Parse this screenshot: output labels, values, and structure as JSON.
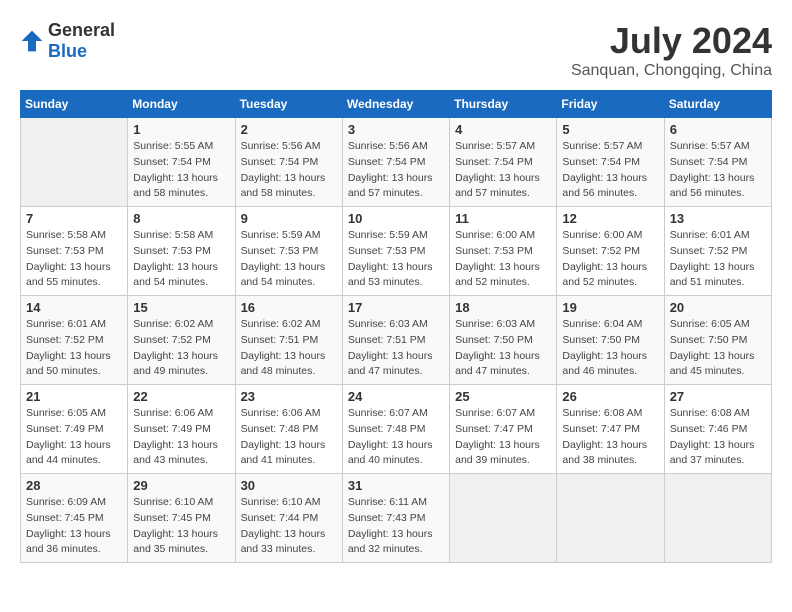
{
  "header": {
    "logo_general": "General",
    "logo_blue": "Blue",
    "title": "July 2024",
    "subtitle": "Sanquan, Chongqing, China"
  },
  "calendar": {
    "days_of_week": [
      "Sunday",
      "Monday",
      "Tuesday",
      "Wednesday",
      "Thursday",
      "Friday",
      "Saturday"
    ],
    "weeks": [
      [
        {
          "day": "",
          "content": ""
        },
        {
          "day": "1",
          "content": "Sunrise: 5:55 AM\nSunset: 7:54 PM\nDaylight: 13 hours\nand 58 minutes."
        },
        {
          "day": "2",
          "content": "Sunrise: 5:56 AM\nSunset: 7:54 PM\nDaylight: 13 hours\nand 58 minutes."
        },
        {
          "day": "3",
          "content": "Sunrise: 5:56 AM\nSunset: 7:54 PM\nDaylight: 13 hours\nand 57 minutes."
        },
        {
          "day": "4",
          "content": "Sunrise: 5:57 AM\nSunset: 7:54 PM\nDaylight: 13 hours\nand 57 minutes."
        },
        {
          "day": "5",
          "content": "Sunrise: 5:57 AM\nSunset: 7:54 PM\nDaylight: 13 hours\nand 56 minutes."
        },
        {
          "day": "6",
          "content": "Sunrise: 5:57 AM\nSunset: 7:54 PM\nDaylight: 13 hours\nand 56 minutes."
        }
      ],
      [
        {
          "day": "7",
          "content": "Sunrise: 5:58 AM\nSunset: 7:53 PM\nDaylight: 13 hours\nand 55 minutes."
        },
        {
          "day": "8",
          "content": "Sunrise: 5:58 AM\nSunset: 7:53 PM\nDaylight: 13 hours\nand 54 minutes."
        },
        {
          "day": "9",
          "content": "Sunrise: 5:59 AM\nSunset: 7:53 PM\nDaylight: 13 hours\nand 54 minutes."
        },
        {
          "day": "10",
          "content": "Sunrise: 5:59 AM\nSunset: 7:53 PM\nDaylight: 13 hours\nand 53 minutes."
        },
        {
          "day": "11",
          "content": "Sunrise: 6:00 AM\nSunset: 7:53 PM\nDaylight: 13 hours\nand 52 minutes."
        },
        {
          "day": "12",
          "content": "Sunrise: 6:00 AM\nSunset: 7:52 PM\nDaylight: 13 hours\nand 52 minutes."
        },
        {
          "day": "13",
          "content": "Sunrise: 6:01 AM\nSunset: 7:52 PM\nDaylight: 13 hours\nand 51 minutes."
        }
      ],
      [
        {
          "day": "14",
          "content": "Sunrise: 6:01 AM\nSunset: 7:52 PM\nDaylight: 13 hours\nand 50 minutes."
        },
        {
          "day": "15",
          "content": "Sunrise: 6:02 AM\nSunset: 7:52 PM\nDaylight: 13 hours\nand 49 minutes."
        },
        {
          "day": "16",
          "content": "Sunrise: 6:02 AM\nSunset: 7:51 PM\nDaylight: 13 hours\nand 48 minutes."
        },
        {
          "day": "17",
          "content": "Sunrise: 6:03 AM\nSunset: 7:51 PM\nDaylight: 13 hours\nand 47 minutes."
        },
        {
          "day": "18",
          "content": "Sunrise: 6:03 AM\nSunset: 7:50 PM\nDaylight: 13 hours\nand 47 minutes."
        },
        {
          "day": "19",
          "content": "Sunrise: 6:04 AM\nSunset: 7:50 PM\nDaylight: 13 hours\nand 46 minutes."
        },
        {
          "day": "20",
          "content": "Sunrise: 6:05 AM\nSunset: 7:50 PM\nDaylight: 13 hours\nand 45 minutes."
        }
      ],
      [
        {
          "day": "21",
          "content": "Sunrise: 6:05 AM\nSunset: 7:49 PM\nDaylight: 13 hours\nand 44 minutes."
        },
        {
          "day": "22",
          "content": "Sunrise: 6:06 AM\nSunset: 7:49 PM\nDaylight: 13 hours\nand 43 minutes."
        },
        {
          "day": "23",
          "content": "Sunrise: 6:06 AM\nSunset: 7:48 PM\nDaylight: 13 hours\nand 41 minutes."
        },
        {
          "day": "24",
          "content": "Sunrise: 6:07 AM\nSunset: 7:48 PM\nDaylight: 13 hours\nand 40 minutes."
        },
        {
          "day": "25",
          "content": "Sunrise: 6:07 AM\nSunset: 7:47 PM\nDaylight: 13 hours\nand 39 minutes."
        },
        {
          "day": "26",
          "content": "Sunrise: 6:08 AM\nSunset: 7:47 PM\nDaylight: 13 hours\nand 38 minutes."
        },
        {
          "day": "27",
          "content": "Sunrise: 6:08 AM\nSunset: 7:46 PM\nDaylight: 13 hours\nand 37 minutes."
        }
      ],
      [
        {
          "day": "28",
          "content": "Sunrise: 6:09 AM\nSunset: 7:45 PM\nDaylight: 13 hours\nand 36 minutes."
        },
        {
          "day": "29",
          "content": "Sunrise: 6:10 AM\nSunset: 7:45 PM\nDaylight: 13 hours\nand 35 minutes."
        },
        {
          "day": "30",
          "content": "Sunrise: 6:10 AM\nSunset: 7:44 PM\nDaylight: 13 hours\nand 33 minutes."
        },
        {
          "day": "31",
          "content": "Sunrise: 6:11 AM\nSunset: 7:43 PM\nDaylight: 13 hours\nand 32 minutes."
        },
        {
          "day": "",
          "content": ""
        },
        {
          "day": "",
          "content": ""
        },
        {
          "day": "",
          "content": ""
        }
      ]
    ]
  }
}
